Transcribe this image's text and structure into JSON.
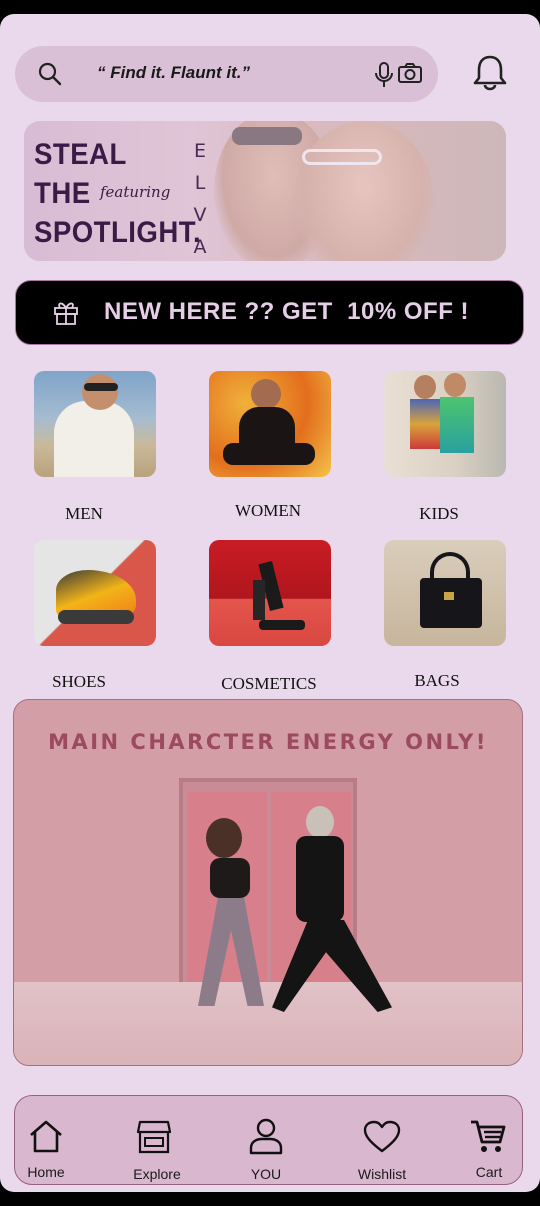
{
  "search": {
    "text": "“ Find  it. Flaunt it.”"
  },
  "hero": {
    "headline_lines": [
      "STEAL",
      "THE",
      "SPOTLIGHT."
    ],
    "featuring": "featuring",
    "brand_letters": [
      "E",
      "L",
      "V",
      "A"
    ]
  },
  "promo": {
    "text": "NEW HERE ?? GET  10% OFF !"
  },
  "categories": [
    {
      "label": "MEN"
    },
    {
      "label": "WOMEN"
    },
    {
      "label": "KIDS"
    },
    {
      "label": "SHOES"
    },
    {
      "label": "COSMETICS"
    },
    {
      "label": "BAGS"
    }
  ],
  "main_banner": {
    "title": "MAIN CHARCTER ENERGY ONLY!"
  },
  "nav": [
    {
      "label": "Home",
      "icon": "home-icon"
    },
    {
      "label": "Explore",
      "icon": "store-icon"
    },
    {
      "label": "YOU",
      "icon": "user-icon"
    },
    {
      "label": "Wishlist",
      "icon": "heart-icon"
    },
    {
      "label": "Cart",
      "icon": "cart-icon"
    }
  ],
  "colors": {
    "background": "#ead9ec",
    "search_bg": "#d9c0d6",
    "promo_bg": "#000000",
    "promo_text": "#e6cfe6",
    "banner_bg": "#d49ea6",
    "banner_title": "#9c4a5e",
    "nav_bg": "#d9b7cf"
  }
}
